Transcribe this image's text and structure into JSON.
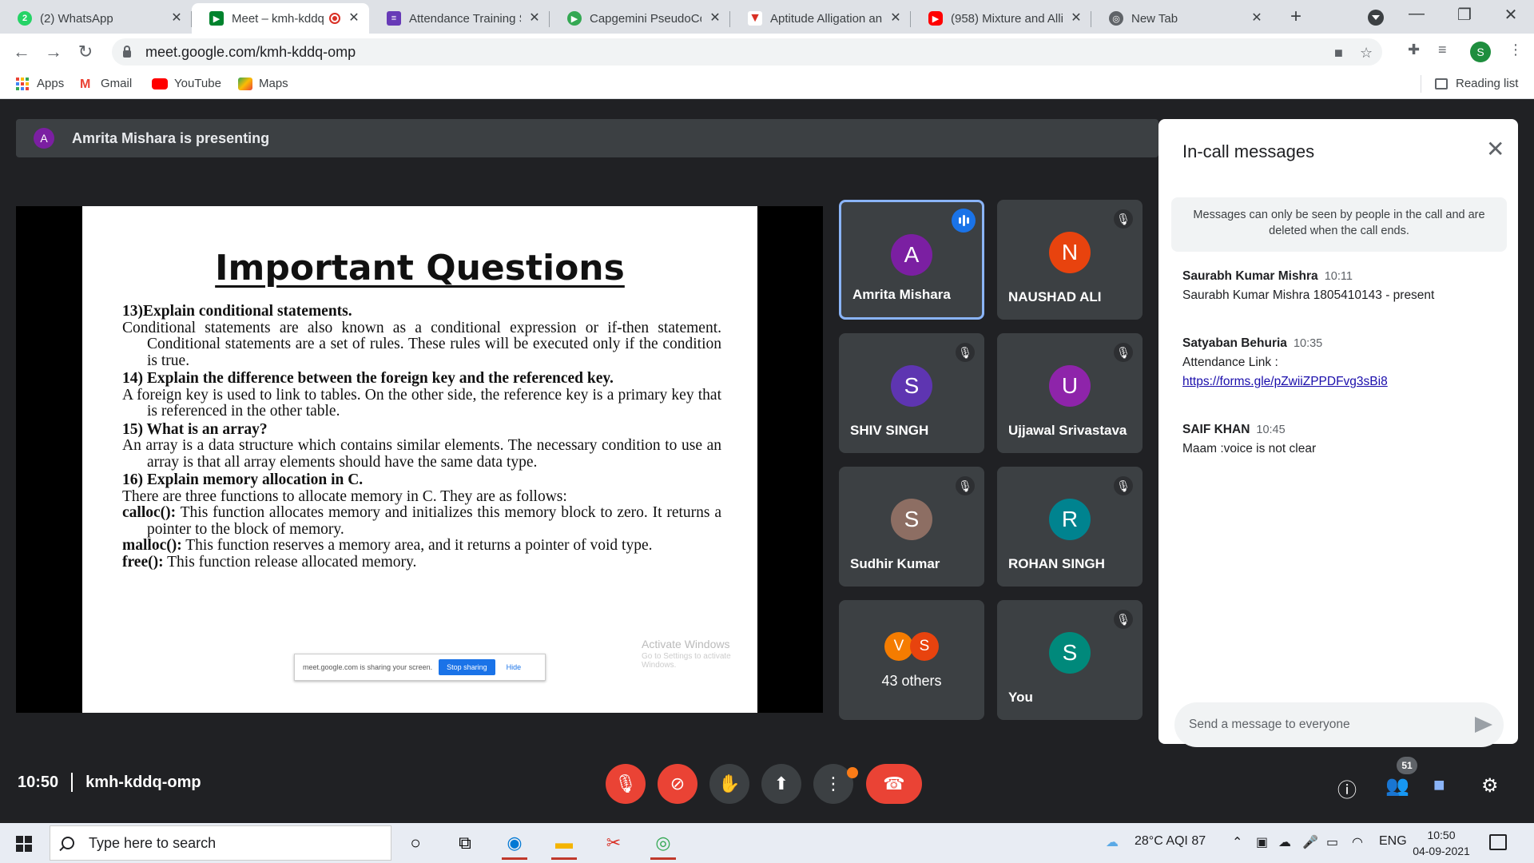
{
  "browser": {
    "tabs": [
      {
        "title": "(2) WhatsApp",
        "icon": "whatsapp-icon",
        "color": "#25d366",
        "glyph": "2"
      },
      {
        "title": "Meet – kmh-kddq",
        "icon": "google-meet-icon",
        "color": "#00832d",
        "glyph": "▶"
      },
      {
        "title": "Attendance Training S",
        "icon": "google-forms-icon",
        "color": "#673ab7",
        "glyph": "≡"
      },
      {
        "title": "Capgemini PseudoCo",
        "icon": "capgemini-icon",
        "color": "#34a853",
        "glyph": "▶"
      },
      {
        "title": "Aptitude Alligation an",
        "icon": "indiabix-icon",
        "color": "#d93025",
        "glyph": "▼"
      },
      {
        "title": "(958) Mixture and Alli",
        "icon": "youtube-icon",
        "color": "#ff0000",
        "glyph": "▶"
      },
      {
        "title": "New Tab",
        "icon": "chrome-icon",
        "color": "#5f6368",
        "glyph": "◎"
      }
    ],
    "url": "meet.google.com/kmh-kddq-omp",
    "profile_initial": "S",
    "bookmarks": [
      "Apps",
      "Gmail",
      "YouTube",
      "Maps"
    ],
    "reading_list": "Reading list"
  },
  "meet": {
    "presenter_initial": "A",
    "presenting_text": "Amrita Mishara is presenting",
    "slide": {
      "title": "Important Questions",
      "q13": "13)Explain conditional statements.",
      "a13": "Conditional statements are also known as a conditional expression or if-then statement. Conditional statements are a set of rules. These rules will be executed only if the condition is true.",
      "q14": "14) Explain the difference between the foreign key and the referenced key.",
      "a14": "A foreign key is used to link to tables. On the other side, the reference key is a primary key that is referenced in the other table.",
      "q15": "15) What is an array?",
      "a15": "An array is a data structure which contains similar elements. The necessary condition to use an array is that all array elements should have the same data type.",
      "q16": "16) Explain memory allocation in C.",
      "a16": "There are three functions to allocate memory in C. They are as follows:",
      "calloc_label": "calloc():",
      "calloc_text": " This function allocates memory and initializes this memory block to zero. It returns a pointer to the block of memory.",
      "malloc_label": "malloc():",
      "malloc_text": " This function reserves a memory area, and it returns a pointer of void type.",
      "free_label": "free():",
      "free_text": " This function release allocated memory.",
      "share_text": "meet.google.com is sharing your screen.",
      "stop_sharing": "Stop sharing",
      "hide": "Hide",
      "activate_title": "Activate Windows",
      "activate_sub": "Go to Settings to activate Windows."
    },
    "participants": [
      {
        "initial": "A",
        "name": "Amrita Mishara",
        "color": "#7b1fa2",
        "speaking": true
      },
      {
        "initial": "N",
        "name": "NAUSHAD ALI",
        "color": "#e8430e",
        "speaking": false
      },
      {
        "initial": "S",
        "name": "SHIV SINGH",
        "color": "#5e35b1",
        "speaking": false
      },
      {
        "initial": "U",
        "name": "Ujjawal Srivastava",
        "color": "#8e24aa",
        "speaking": false
      },
      {
        "initial": "S",
        "name": "Sudhir Kumar",
        "color": "#8d6e63",
        "speaking": false
      },
      {
        "initial": "R",
        "name": "ROHAN SINGH",
        "color": "#00838f",
        "speaking": false
      },
      {
        "initial": "S",
        "name": "You",
        "color": "#00897b",
        "speaking": false
      }
    ],
    "others": {
      "label": "43 others",
      "initials": [
        "V",
        "S"
      ],
      "colors": [
        "#f57c00",
        "#e8430e"
      ]
    },
    "meeting_time": "10:50",
    "meeting_code": "kmh-kddq-omp",
    "people_count": "51"
  },
  "chat": {
    "title": "In-call messages",
    "note": "Messages can only be seen by people in the call and are deleted when the call ends.",
    "messages": [
      {
        "sender": "Saurabh Kumar Mishra",
        "time": "10:11",
        "text": "Saurabh Kumar Mishra 1805410143 - present"
      },
      {
        "sender": "Satyaban Behuria",
        "time": "10:35",
        "text": "Attendance Link :",
        "link": "https://forms.gle/pZwiiZPPDFvg3sBi8"
      },
      {
        "sender": "SAIF KHAN",
        "time": "10:45",
        "text": "Maam :voice is not clear"
      }
    ],
    "input_placeholder": "Send a message to everyone"
  },
  "taskbar": {
    "search_placeholder": "Type here to search",
    "weather": "28°C AQI 87",
    "language": "ENG",
    "time": "10:50",
    "date": "04-09-2021"
  }
}
